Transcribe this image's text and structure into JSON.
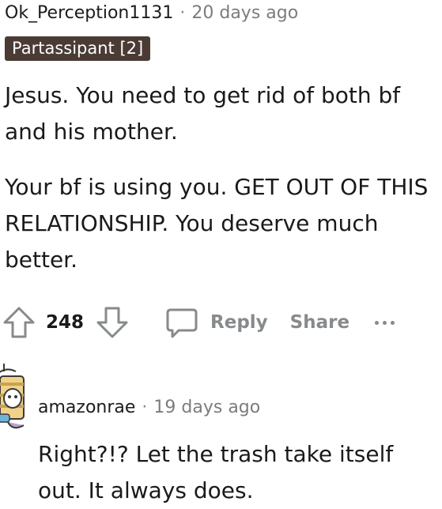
{
  "comment": {
    "username": "Ok_Perception1131",
    "separator": "·",
    "timestamp": "20 days ago",
    "flair": "Partassipant [2]",
    "paragraphs": [
      "Jesus. You need to get rid of both bf and his mother.",
      "Your bf is using you. GET OUT OF THIS RELATIONSHIP. You deserve much better."
    ],
    "actions": {
      "upvote_icon": "upvote-arrow-icon",
      "vote_count": "248",
      "downvote_icon": "downvote-arrow-icon",
      "reply_icon": "speech-bubble-icon",
      "reply_label": "Reply",
      "share_label": "Share",
      "more_icon": "more-dots-icon"
    }
  },
  "reply": {
    "avatar_icon": "user-avatar-icon",
    "username": "amazonrae",
    "separator": "·",
    "timestamp": "19 days ago",
    "text": "Right?!? Let the trash take itself out. It always does."
  },
  "colors": {
    "flair_bg": "#4a3c35",
    "muted_text": "#878a8c",
    "body_text": "#1a1a1b"
  }
}
